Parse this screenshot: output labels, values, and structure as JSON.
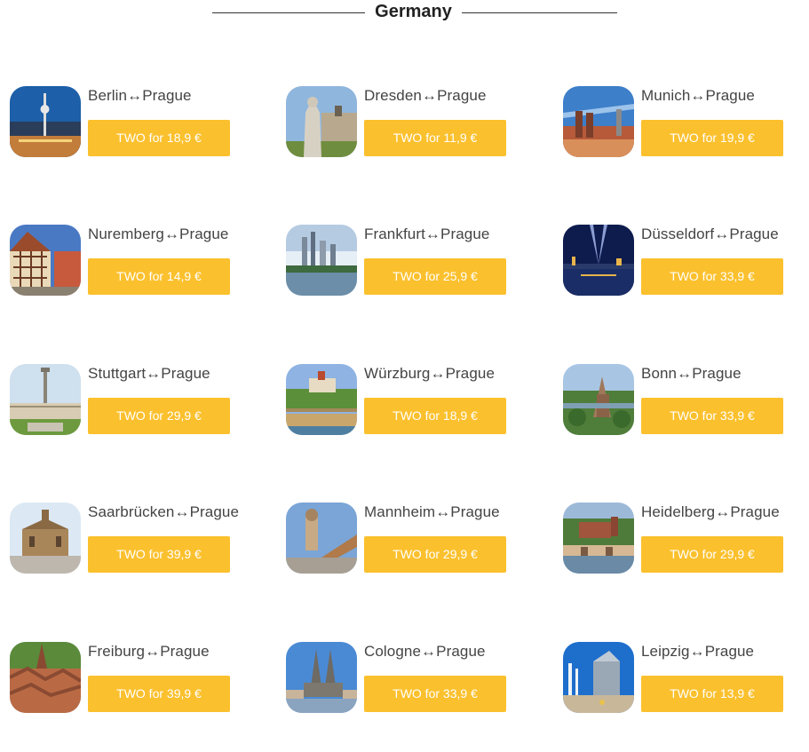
{
  "header": {
    "title": "Germany"
  },
  "separator": "↔",
  "cities": [
    {
      "from": "Berlin",
      "to": "Prague",
      "price": "TWO for 18,9 €",
      "icon": "berlin-tv-tower-photo"
    },
    {
      "from": "Dresden",
      "to": "Prague",
      "price": "TWO for 11,9 €",
      "icon": "dresden-statue-photo"
    },
    {
      "from": "Munich",
      "to": "Prague",
      "price": "TWO for 19,9 €",
      "icon": "munich-cityscape-photo"
    },
    {
      "from": "Nuremberg",
      "to": "Prague",
      "price": "TWO for 14,9 €",
      "icon": "nuremberg-timber-houses-photo"
    },
    {
      "from": "Frankfurt",
      "to": "Prague",
      "price": "TWO for 25,9 €",
      "icon": "frankfurt-skyline-photo"
    },
    {
      "from": "Düsseldorf",
      "to": "Prague",
      "price": "TWO for 33,9 €",
      "icon": "dusseldorf-night-photo"
    },
    {
      "from": "Stuttgart",
      "to": "Prague",
      "price": "TWO for 29,9 €",
      "icon": "stuttgart-column-photo"
    },
    {
      "from": "Würzburg",
      "to": "Prague",
      "price": "TWO for 18,9 €",
      "icon": "wurzburg-fortress-photo"
    },
    {
      "from": "Bonn",
      "to": "Prague",
      "price": "TWO for 33,9 €",
      "icon": "bonn-castle-photo"
    },
    {
      "from": "Saarbrücken",
      "to": "Prague",
      "price": "TWO for 39,9 €",
      "icon": "saarbrucken-church-photo"
    },
    {
      "from": "Mannheim",
      "to": "Prague",
      "price": "TWO for 29,9 €",
      "icon": "mannheim-water-tower-photo"
    },
    {
      "from": "Heidelberg",
      "to": "Prague",
      "price": "TWO for 29,9 €",
      "icon": "heidelberg-castle-photo"
    },
    {
      "from": "Freiburg",
      "to": "Prague",
      "price": "TWO for 39,9 €",
      "icon": "freiburg-rooftops-photo"
    },
    {
      "from": "Cologne",
      "to": "Prague",
      "price": "TWO for 33,9 €",
      "icon": "cologne-cathedral-photo"
    },
    {
      "from": "Leipzig",
      "to": "Prague",
      "price": "TWO for 13,9 €",
      "icon": "leipzig-modern-building-photo"
    }
  ],
  "colors": {
    "button": "#fbc02d",
    "button_text": "#ffffff",
    "title": "#222222",
    "route_text": "#444444"
  }
}
